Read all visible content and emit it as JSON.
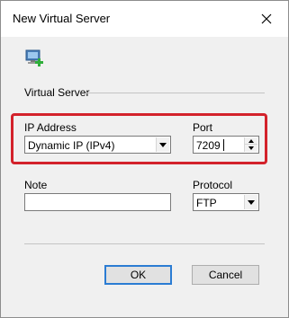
{
  "window": {
    "title": "New Virtual Server"
  },
  "icons": {
    "app": "network-add-icon",
    "close": "close-icon"
  },
  "group": {
    "label": "Virtual Server"
  },
  "ip_address": {
    "label": "IP Address",
    "value": "Dynamic IP (IPv4)"
  },
  "port": {
    "label": "Port",
    "value": "7209"
  },
  "note": {
    "label": "Note",
    "value": ""
  },
  "protocol": {
    "label": "Protocol",
    "value": "FTP"
  },
  "buttons": {
    "ok": "OK",
    "cancel": "Cancel"
  },
  "colors": {
    "highlight": "#d3222b",
    "default_button_border": "#2b7cd3"
  }
}
